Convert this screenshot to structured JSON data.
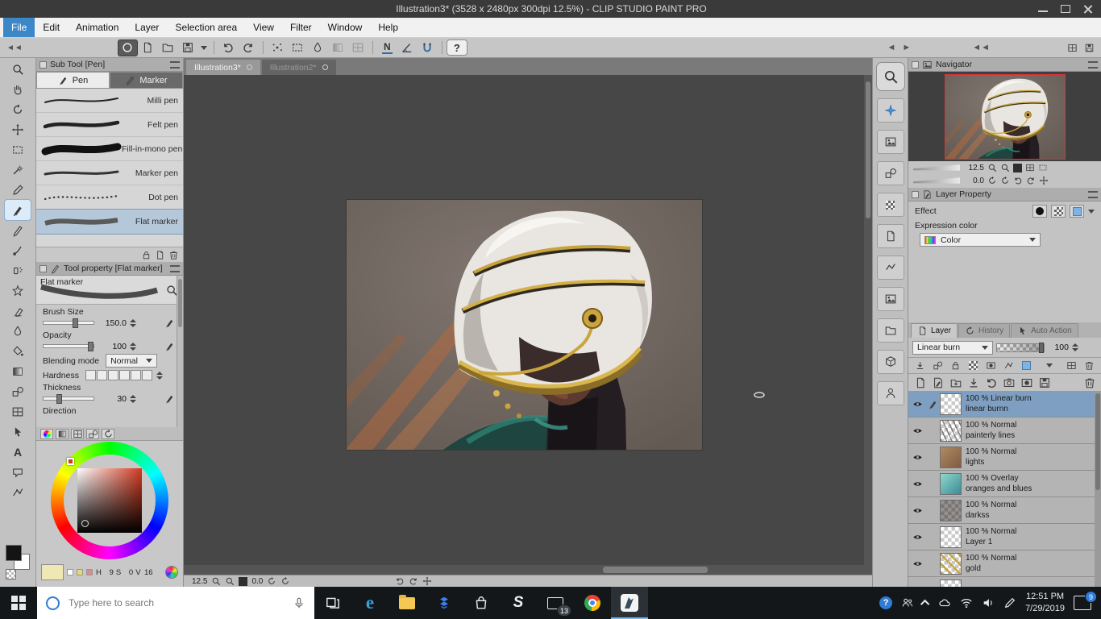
{
  "app": {
    "title": "Illustration3* (3528 x 2480px 300dpi 12.5%) - CLIP STUDIO PAINT PRO"
  },
  "menu_bar": {
    "items": [
      "File",
      "Edit",
      "Animation",
      "Layer",
      "Selection area",
      "View",
      "Filter",
      "Window",
      "Help"
    ],
    "active_item": "File"
  },
  "toolbar": {
    "icons": [
      "app-logo",
      "new-file",
      "open-file",
      "save",
      "save-options",
      "undo",
      "redo",
      "scatter",
      "deselect",
      "blend-drop",
      "transform",
      "crop",
      "snap-ruler",
      "snap-angle",
      "snap-magnet",
      "help"
    ],
    "snap_glyph": "N",
    "help_label": "?"
  },
  "document_tabs": {
    "tab1": "Illustration3*",
    "tab2": "Illustration2*"
  },
  "left_toolbar": {
    "tools": [
      "zoom",
      "hand",
      "rotate",
      "move-layer",
      "selection",
      "auto-select",
      "eyedropper",
      "pen",
      "pencil",
      "brush",
      "airbrush",
      "decoration",
      "eraser",
      "blend",
      "fill",
      "gradient",
      "figure",
      "frame-border",
      "operation",
      "text",
      "balloon",
      "correct-line"
    ],
    "selected_tool": "pen",
    "text_tool_glyph": "A"
  },
  "sub_tool_panel": {
    "title": "Sub Tool [Pen]",
    "tab_pen": "Pen",
    "tab_marker": "Marker",
    "items": [
      "Milli pen",
      "Felt pen",
      "Fill-in-mono pen",
      "Marker pen",
      "Dot pen",
      "Flat marker"
    ],
    "selected_item": "Flat marker"
  },
  "tool_property_panel": {
    "title": "Tool property [Flat marker]",
    "tool_name": "Flat marker",
    "brush_size_label": "Brush Size",
    "brush_size_value": "150.0",
    "opacity_label": "Opacity",
    "opacity_value": "100",
    "blending_label": "Blending mode",
    "blending_value": "Normal",
    "hardness_label": "Hardness",
    "thickness_label": "Thickness",
    "thickness_value": "30",
    "direction_label": "Direction"
  },
  "color_panel": {
    "h_label": "H",
    "h_value": "9",
    "s_label": "S",
    "s_value": "0",
    "v_label": "V",
    "v_value": "16",
    "selected_color_hex": "#2b1713"
  },
  "canvas_status": {
    "zoom": "12.5",
    "rotation": "0.0"
  },
  "midstrip": {
    "icons": [
      "quick-access",
      "material-star",
      "sub-view",
      "item-bank",
      "tone-pattern",
      "monochrome-pattern",
      "image-material",
      "photo-material",
      "manga-material",
      "3d-material",
      "pose-material"
    ]
  },
  "navigator_panel": {
    "title": "Navigator",
    "zoom": "12.5",
    "rotation": "0.0"
  },
  "layer_property_panel": {
    "title": "Layer Property",
    "effect_label": "Effect",
    "expression_label": "Expression color",
    "expression_value": "Color"
  },
  "layer_panel": {
    "tab_layer": "Layer",
    "tab_history": "History",
    "tab_auto": "Auto Action",
    "blend_mode": "Linear burn",
    "opacity_value": "100",
    "layers": [
      {
        "info": "100 % Linear burn",
        "name": "linear burnn",
        "selected": true
      },
      {
        "info": "100 % Normal",
        "name": "painterly lines",
        "selected": false
      },
      {
        "info": "100 % Normal",
        "name": "lights",
        "selected": false
      },
      {
        "info": "100 % Overlay",
        "name": "oranges and blues",
        "selected": false
      },
      {
        "info": "100 % Normal",
        "name": "darkss",
        "selected": false
      },
      {
        "info": "100 % Normal",
        "name": "Layer 1",
        "selected": false
      },
      {
        "info": "100 % Normal",
        "name": "gold",
        "selected": false
      }
    ]
  },
  "taskbar": {
    "search_placeholder": "Type here to search",
    "app_icons": [
      "start",
      "task-view",
      "edge",
      "file-explorer",
      "dropbox",
      "store",
      "s-app",
      "mail",
      "chrome",
      "clip-studio-paint"
    ],
    "active_app": "clip-studio-paint",
    "edge_letter": "e",
    "s_letter": "S",
    "mail_badge": "13",
    "tray_icons": [
      "help",
      "people",
      "hidden-icons",
      "onedrive",
      "network",
      "volume",
      "windows-ink"
    ],
    "time": "12:51 PM",
    "date": "7/29/2019",
    "notification_badge": "9"
  }
}
